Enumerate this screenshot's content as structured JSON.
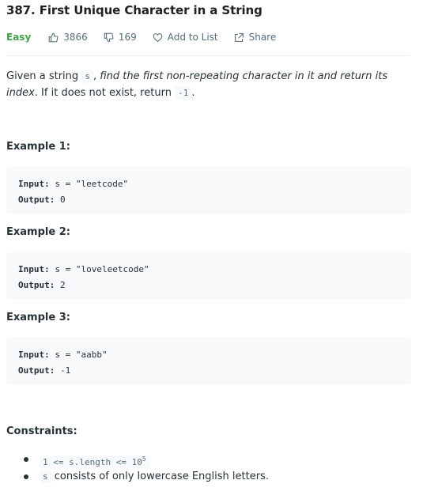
{
  "problem": {
    "number": "387.",
    "title": "First Unique Character in a String"
  },
  "meta": {
    "difficulty": "Easy",
    "likes": "3866",
    "dislikes": "169",
    "add_to_list": "Add to List",
    "share": "Share",
    "colors": {
      "difficulty": "#43a047",
      "meta_text": "#546e7a"
    }
  },
  "description": {
    "p1": "Given a string ",
    "code_s": "s",
    "p2": ", ",
    "emph": "find the first non-repeating character in it and return its index",
    "p3": ". If it does not exist, return ",
    "code_neg": "-1",
    "p4": "."
  },
  "examples": [
    {
      "title": "Example 1:",
      "input_label": "Input:",
      "input_value": "s = \"leetcode\"",
      "output_label": "Output:",
      "output_value": "0"
    },
    {
      "title": "Example 2:",
      "input_label": "Input:",
      "input_value": "s = \"loveleetcode\"",
      "output_label": "Output:",
      "output_value": "2"
    },
    {
      "title": "Example 3:",
      "input_label": "Input:",
      "input_value": "s = \"aabb\"",
      "output_label": "Output:",
      "output_value": "-1"
    }
  ],
  "constraints": {
    "title": "Constraints:",
    "c1_code": "1 <= s.length <= 10",
    "c1_sup": "5",
    "c2_code": "s",
    "c2_text": " consists of only lowercase English letters."
  }
}
